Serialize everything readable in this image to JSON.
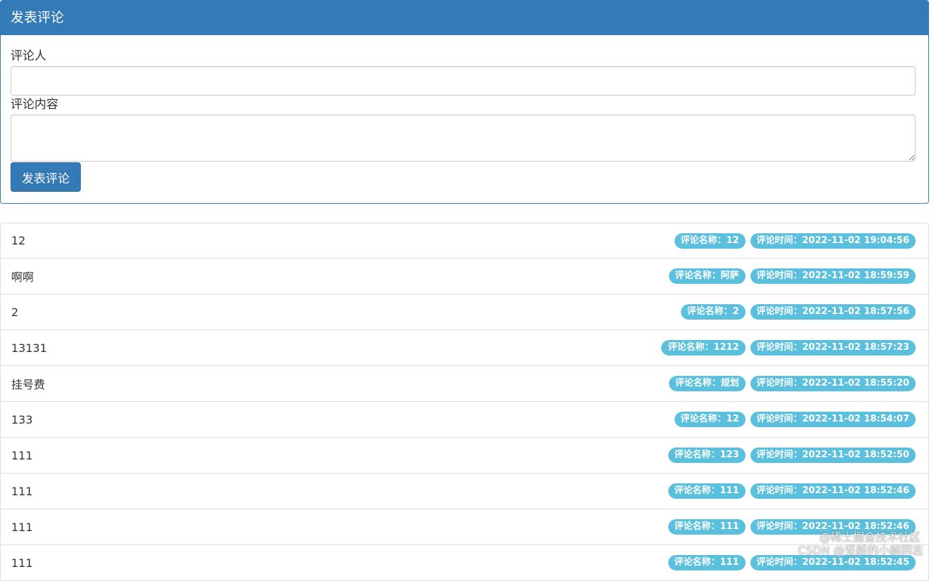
{
  "form": {
    "title": "发表评论",
    "author_label": "评论人",
    "author_value": "",
    "content_label": "评论内容",
    "content_value": "",
    "submit_label": "发表评论"
  },
  "comments": [
    {
      "text": "12",
      "name_badge": "评论名称：12",
      "time_badge": "评论时间：2022-11-02 19:04:56"
    },
    {
      "text": "啊啊",
      "name_badge": "评论名称：阿萨",
      "time_badge": "评论时间：2022-11-02 18:59:59"
    },
    {
      "text": "2",
      "name_badge": "评论名称：2",
      "time_badge": "评论时间：2022-11-02 18:57:56"
    },
    {
      "text": "13131",
      "name_badge": "评论名称：1212",
      "time_badge": "评论时间：2022-11-02 18:57:23"
    },
    {
      "text": "挂号费",
      "name_badge": "评论名称：规划",
      "time_badge": "评论时间：2022-11-02 18:55:20"
    },
    {
      "text": "133",
      "name_badge": "评论名称：12",
      "time_badge": "评论时间：2022-11-02 18:54:07"
    },
    {
      "text": "111",
      "name_badge": "评论名称：123",
      "time_badge": "评论时间：2022-11-02 18:52:50"
    },
    {
      "text": "111",
      "name_badge": "评论名称：111",
      "time_badge": "评论时间：2022-11-02 18:52:46"
    },
    {
      "text": "111",
      "name_badge": "评论名称：111",
      "time_badge": "评论时间：2022-11-02 18:52:46"
    },
    {
      "text": "111",
      "name_badge": "评论名称：111",
      "time_badge": "评论时间：2022-11-02 18:52:45"
    }
  ],
  "watermark": {
    "line1": "@稀土掘金技术社区",
    "line2": "CSDN @坚毅的小解同志"
  }
}
